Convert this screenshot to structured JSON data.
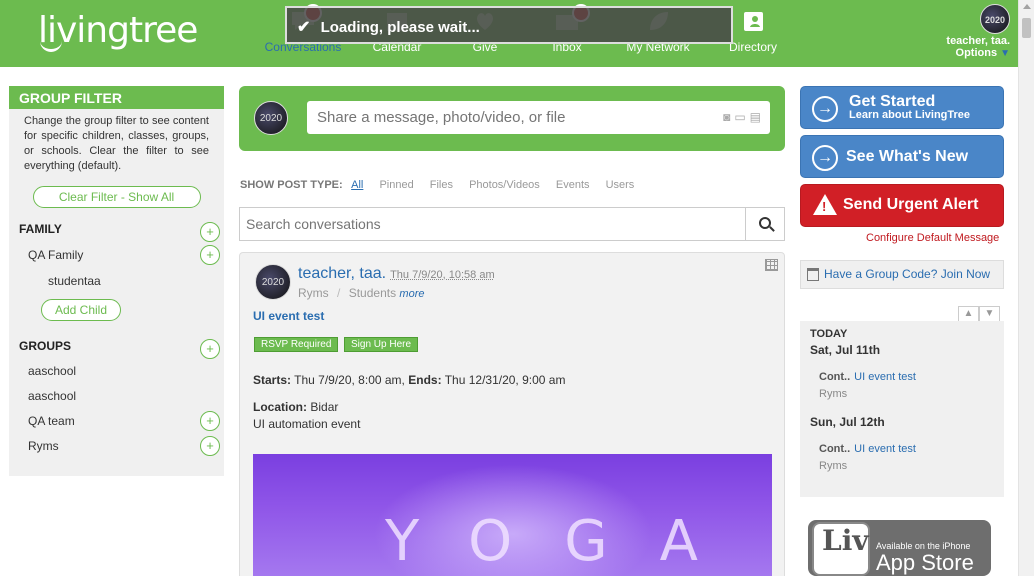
{
  "colors": {
    "brand_green": "#6cbb4f",
    "link_blue": "#2a6db0",
    "alert_red": "#d11f26",
    "button_blue": "#4a86c8"
  },
  "header": {
    "logo": "livingtree",
    "nav": [
      {
        "label": "Conversations",
        "icon": "chat-icon",
        "active": true
      },
      {
        "label": "Calendar",
        "icon": "calendar-icon"
      },
      {
        "label": "Give",
        "icon": "give-icon"
      },
      {
        "label": "Inbox",
        "icon": "inbox-icon"
      },
      {
        "label": "My Network",
        "icon": "network-icon"
      },
      {
        "label": "Directory",
        "icon": "directory-icon"
      }
    ],
    "loading": "Loading, please wait...",
    "user": {
      "avatar_text": "2020",
      "name": "teacher, taa.",
      "options": "Options"
    }
  },
  "group_filter": {
    "title": "GROUP FILTER",
    "description": "Change the group filter to see content for specific children, classes, groups, or schools. Clear the filter to see everything (default).",
    "clear_label": "Clear Filter - Show All",
    "family_label": "FAMILY",
    "family_items": [
      "QA Family",
      "studentaa"
    ],
    "add_child_label": "Add Child",
    "groups_label": "GROUPS",
    "groups_items": [
      "aaschool",
      "aaschool",
      "QA team",
      "Ryms"
    ]
  },
  "share": {
    "avatar_text": "2020",
    "placeholder": "Share a message, photo/video, or file"
  },
  "post_type": {
    "label": "SHOW POST TYPE:",
    "options": [
      "All",
      "Pinned",
      "Files",
      "Photos/Videos",
      "Events",
      "Users"
    ]
  },
  "search": {
    "placeholder": "Search conversations"
  },
  "post": {
    "avatar_text": "2020",
    "author": "teacher, taa.",
    "date": "Thu 7/9/20, 10:58 am",
    "group": "Ryms",
    "separator": "/",
    "audience": "Students",
    "more": "more",
    "title": "UI event test",
    "buttons": [
      "RSVP Required",
      "Sign Up Here"
    ],
    "starts_label": "Starts:",
    "starts_value": "Thu 7/9/20, 8:00 am,",
    "ends_label": "Ends:",
    "ends_value": "Thu 12/31/20, 9:00 am",
    "location_label": "Location:",
    "location_value": "Bidar",
    "description": "UI automation event",
    "image_text": "YOGA"
  },
  "right": {
    "get_started": {
      "title": "Get Started",
      "subtitle": "Learn about LivingTree"
    },
    "whats_new": {
      "title": "See What's New"
    },
    "urgent": {
      "title": "Send Urgent Alert"
    },
    "configure": "Configure Default Message",
    "group_code": "Have a Group Code? Join Now",
    "calendar": {
      "today": "TODAY",
      "days": [
        {
          "date": "Sat, Jul 11th",
          "cont": "Cont..",
          "event": "UI event test",
          "location": "Ryms"
        },
        {
          "date": "Sun, Jul 12th",
          "cont": "Cont..",
          "event": "UI event test",
          "location": "Ryms"
        }
      ]
    },
    "appstore": {
      "logo": "Liv",
      "small": "Available on the iPhone",
      "big": "App Store"
    }
  }
}
